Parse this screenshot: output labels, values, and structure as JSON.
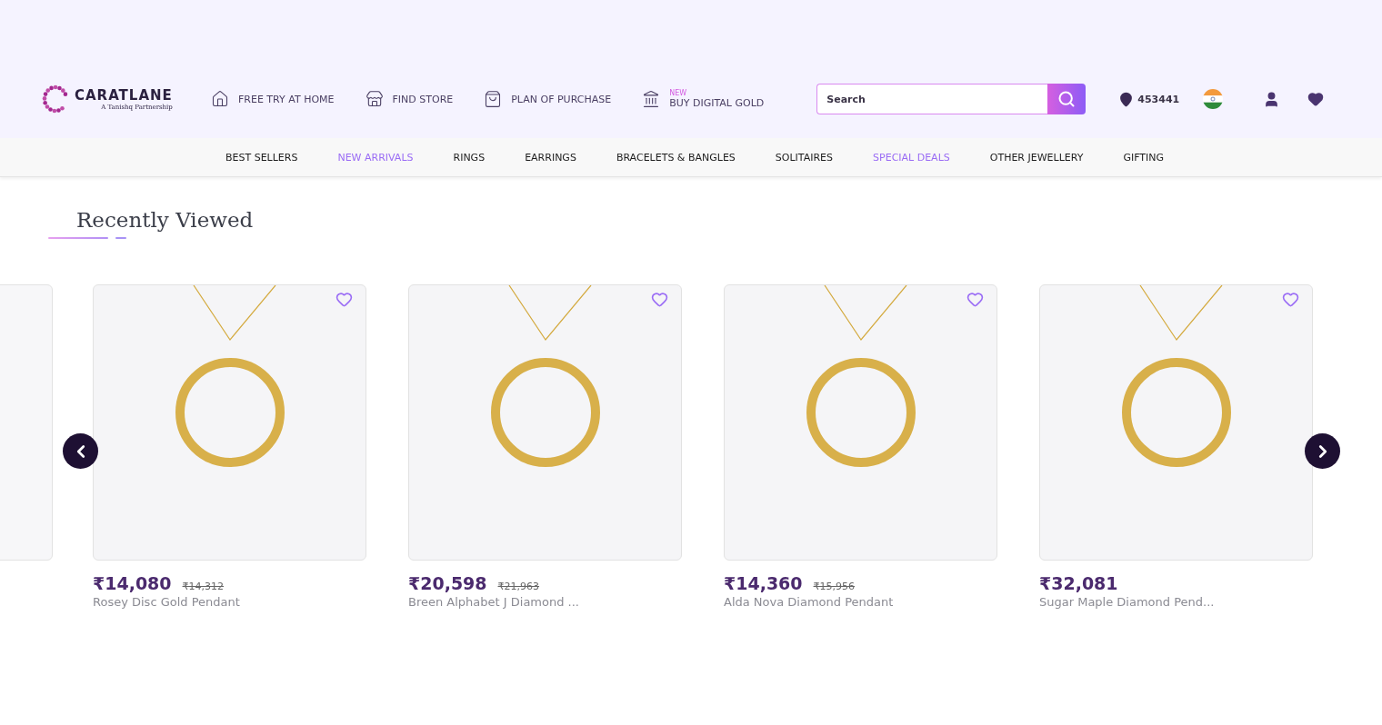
{
  "logo": {
    "name": "CARATLANE",
    "tagline": "A Tanishq Partnership"
  },
  "header_links": [
    {
      "label": "FREE TRY AT HOME"
    },
    {
      "label": "FIND STORE"
    },
    {
      "label": "PLAN OF PURCHASE"
    },
    {
      "label": "BUY DIGITAL GOLD",
      "badge": "NEW"
    }
  ],
  "search": {
    "placeholder": "Search"
  },
  "pincode": "453441",
  "nav": [
    {
      "label": "BEST SELLERS",
      "highlighted": false
    },
    {
      "label": "NEW ARRIVALS",
      "highlighted": true
    },
    {
      "label": "RINGS",
      "highlighted": false
    },
    {
      "label": "EARRINGS",
      "highlighted": false
    },
    {
      "label": "BRACELETS & BANGLES",
      "highlighted": false
    },
    {
      "label": "SOLITAIRES",
      "highlighted": false
    },
    {
      "label": "SPECIAL DEALS",
      "highlighted": true
    },
    {
      "label": "OTHER JEWELLERY",
      "highlighted": false
    },
    {
      "label": "GIFTING",
      "highlighted": false
    }
  ],
  "section_title": "Recently Viewed",
  "products": [
    {
      "price": "₹14,080",
      "old_price": "₹14,312",
      "name": "Rosey Disc Gold Pendant",
      "wishlisted": false
    },
    {
      "price": "₹20,598",
      "old_price": "₹21,963",
      "name": "Breen Alphabet J Diamond ...",
      "wishlisted": false
    },
    {
      "price": "₹14,360",
      "old_price": "₹15,956",
      "name": "Alda Nova Diamond Pendant",
      "wishlisted": false
    },
    {
      "price": "₹32,081",
      "name": "Sugar Maple Diamond Pend...",
      "wishlisted": false
    }
  ]
}
